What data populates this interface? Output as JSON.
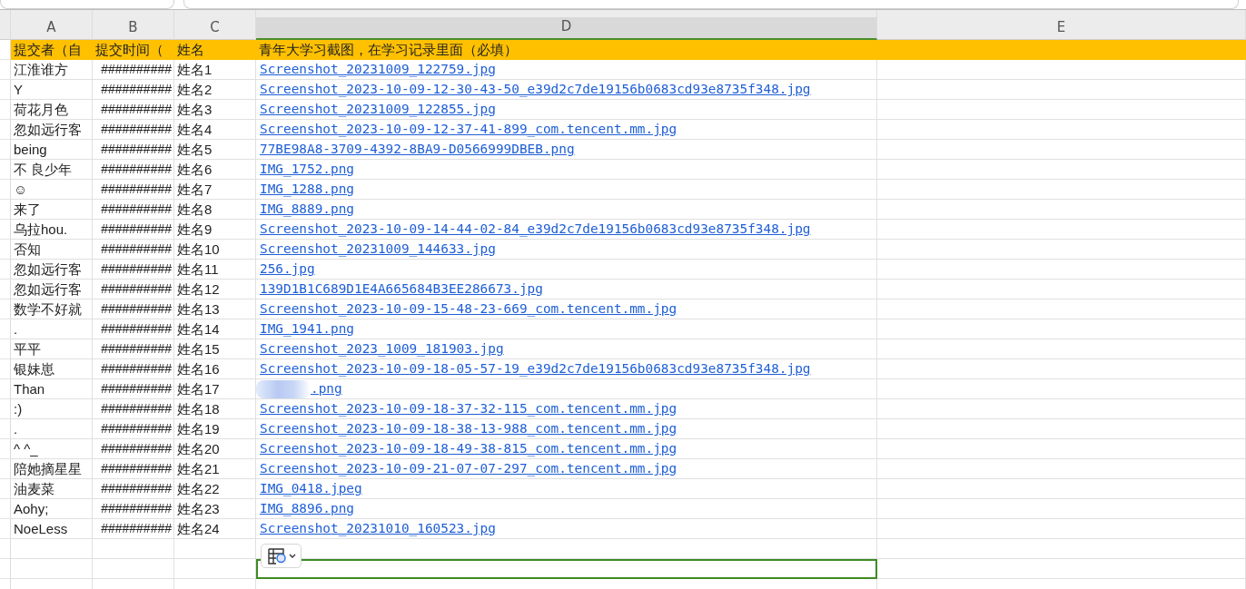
{
  "columns": [
    {
      "label": "A",
      "selected": false
    },
    {
      "label": "B",
      "selected": false
    },
    {
      "label": "C",
      "selected": false
    },
    {
      "label": "D",
      "selected": true
    },
    {
      "label": "E",
      "selected": false
    }
  ],
  "header": [
    "提交者（自",
    "提交时间（",
    "姓名",
    "青年大学习截图，在学习记录里面（必填）"
  ],
  "rows": [
    {
      "submitter": "江淮谁方",
      "time": "##########",
      "name": "姓名1",
      "file": "Screenshot_20231009_122759.jpg",
      "blurred": false
    },
    {
      "submitter": "Y",
      "time": "##########",
      "name": "姓名2",
      "file": "Screenshot_2023-10-09-12-30-43-50_e39d2c7de19156b0683cd93e8735f348.jpg",
      "blurred": false
    },
    {
      "submitter": "荷花月色",
      "time": "##########",
      "name": "姓名3",
      "file": "Screenshot_20231009_122855.jpg",
      "blurred": false
    },
    {
      "submitter": "忽如远行客",
      "time": "##########",
      "name": "姓名4",
      "file": "Screenshot_2023-10-09-12-37-41-899_com.tencent.mm.jpg",
      "blurred": false
    },
    {
      "submitter": "being",
      "time": "##########",
      "name": "姓名5",
      "file": "77BE98A8-3709-4392-8BA9-D0566999DBEB.png",
      "blurred": false
    },
    {
      "submitter": "不 良少年",
      "time": "##########",
      "name": "姓名6",
      "file": "IMG_1752.png",
      "blurred": false
    },
    {
      "submitter": "☺",
      "time": "##########",
      "name": "姓名7",
      "file": "IMG_1288.png",
      "blurred": false
    },
    {
      "submitter": "来了",
      "time": "##########",
      "name": "姓名8",
      "file": "IMG_8889.png",
      "blurred": false
    },
    {
      "submitter": "乌拉hou.",
      "time": "##########",
      "name": "姓名9",
      "file": "Screenshot_2023-10-09-14-44-02-84_e39d2c7de19156b0683cd93e8735f348.jpg",
      "blurred": false
    },
    {
      "submitter": "否知",
      "time": "##########",
      "name": "姓名10",
      "file": "Screenshot_20231009_144633.jpg",
      "blurred": false
    },
    {
      "submitter": "忽如远行客",
      "time": "##########",
      "name": "姓名11",
      "file": "256.jpg",
      "blurred": false
    },
    {
      "submitter": "忽如远行客",
      "time": "##########",
      "name": "姓名12",
      "file": "139D1B1C689D1E4A665684B3EE286673.jpg",
      "blurred": false
    },
    {
      "submitter": "数学不好就",
      "time": "##########",
      "name": "姓名13",
      "file": "Screenshot_2023-10-09-15-48-23-669_com.tencent.mm.jpg",
      "blurred": false
    },
    {
      "submitter": ".",
      "time": "##########",
      "name": "姓名14",
      "file": "IMG_1941.png",
      "blurred": false
    },
    {
      "submitter": "平平",
      "time": "##########",
      "name": "姓名15",
      "file": "Screenshot_2023_1009_181903.jpg",
      "blurred": false
    },
    {
      "submitter": "银妹崽",
      "time": "##########",
      "name": "姓名16",
      "file": "Screenshot_2023-10-09-18-05-57-19_e39d2c7de19156b0683cd93e8735f348.jpg",
      "blurred": false
    },
    {
      "submitter": "Than",
      "time": "##########",
      "name": "姓名17",
      "file": ".png",
      "blurred": true
    },
    {
      "submitter": ":)",
      "time": "##########",
      "name": "姓名18",
      "file": "Screenshot_2023-10-09-18-37-32-115_com.tencent.mm.jpg",
      "blurred": false
    },
    {
      "submitter": ".",
      "time": "##########",
      "name": "姓名19",
      "file": "Screenshot_2023-10-09-18-38-13-988_com.tencent.mm.jpg",
      "blurred": false
    },
    {
      "submitter": "^ ^_",
      "time": "##########",
      "name": "姓名20",
      "file": "Screenshot_2023-10-09-18-49-38-815_com.tencent.mm.jpg",
      "blurred": false
    },
    {
      "submitter": "陪她摘星星",
      "time": "##########",
      "name": "姓名21",
      "file": "Screenshot_2023-10-09-21-07-07-297_com.tencent.mm.jpg",
      "blurred": false
    },
    {
      "submitter": "油麦菜",
      "time": "##########",
      "name": "姓名22",
      "file": "IMG_0418.jpeg",
      "blurred": false
    },
    {
      "submitter": "Aohy;",
      "time": "##########",
      "name": "姓名23",
      "file": "IMG_8896.png",
      "blurred": false
    },
    {
      "submitter": "NoeLess",
      "time": "##########",
      "name": "姓名24",
      "file": "Screenshot_20231010_160523.jpg",
      "blurred": false
    }
  ],
  "empty_rows": [
    {
      "selected": false
    },
    {
      "selected": true
    },
    {
      "selected": false
    }
  ]
}
